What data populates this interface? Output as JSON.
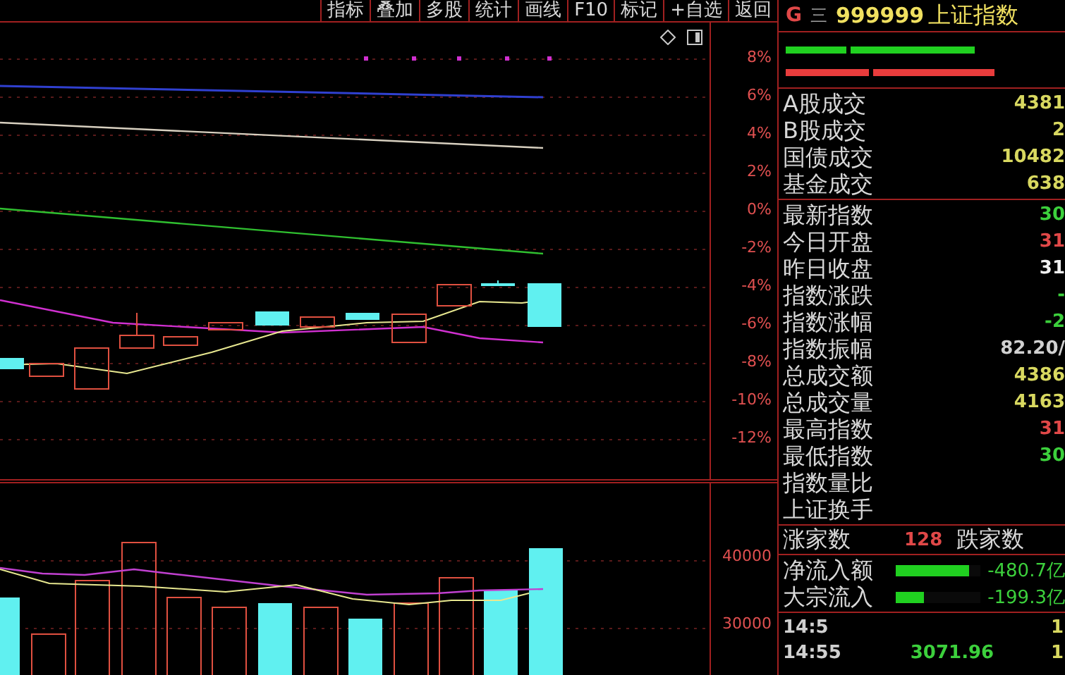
{
  "toolbar": [
    {
      "label": "指标"
    },
    {
      "label": "叠加"
    },
    {
      "label": "多股"
    },
    {
      "label": "统计"
    },
    {
      "label": "画线"
    },
    {
      "label": "F10"
    },
    {
      "label": "标记"
    },
    {
      "label": "+自选"
    },
    {
      "label": "返回"
    }
  ],
  "price_axis": [
    "8%",
    "6%",
    "4%",
    "2%",
    "0%",
    "-2%",
    "-4%",
    "-6%",
    "-8%",
    "-10%",
    "-12%"
  ],
  "volume_axis": [
    "40000",
    "30000"
  ],
  "header": {
    "market": "G",
    "menu": "三",
    "code": "999999",
    "name": "上证指数"
  },
  "turnover": [
    {
      "label": "A股成交",
      "value": "4381",
      "color": "#d8d860"
    },
    {
      "label": "B股成交",
      "value": "2",
      "color": "#d8d860"
    },
    {
      "label": "国债成交",
      "value": "10482",
      "color": "#d8d860"
    },
    {
      "label": "基金成交",
      "value": "638",
      "color": "#d8d860"
    }
  ],
  "stats": [
    {
      "label": "最新指数",
      "value": "30",
      "color": "#3cd03c"
    },
    {
      "label": "今日开盘",
      "value": "31",
      "color": "#e04848"
    },
    {
      "label": "昨日收盘",
      "value": "31",
      "color": "#f0f0f0"
    },
    {
      "label": "指数涨跌",
      "value": "-",
      "color": "#3cd03c"
    },
    {
      "label": "指数涨幅",
      "value": "-2",
      "color": "#3cd03c"
    },
    {
      "label": "指数振幅",
      "value": "82.20/",
      "color": "#d0d0d0"
    },
    {
      "label": "总成交额",
      "value": "4386",
      "color": "#d8d860"
    },
    {
      "label": "总成交量",
      "value": "4163",
      "color": "#d8d860"
    },
    {
      "label": "最高指数",
      "value": "31",
      "color": "#e04848"
    },
    {
      "label": "最低指数",
      "value": "30",
      "color": "#3cd03c"
    },
    {
      "label": "指数量比"
    },
    {
      "label": "上证换手"
    }
  ],
  "breadth": {
    "up_label": "涨家数",
    "up_count": "128",
    "down_label": "跌家数"
  },
  "flows": [
    {
      "label": "净流入额",
      "level": 0.87,
      "value": "-480.7亿"
    },
    {
      "label": "大宗流入",
      "level": 0.33,
      "value": "-199.3亿"
    }
  ],
  "ticks": [
    {
      "time": "14:5",
      "volume": "1"
    },
    {
      "time": "14:55",
      "price": "3071.96",
      "volume": "1"
    }
  ]
}
